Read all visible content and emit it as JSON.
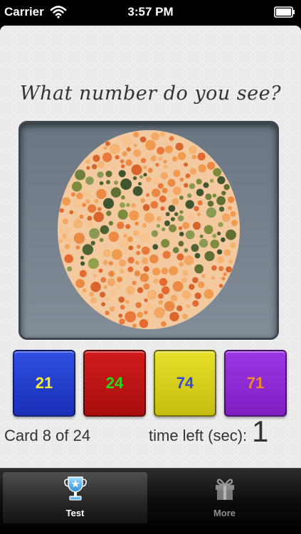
{
  "status_bar": {
    "carrier": "Carrier",
    "time": "3:57 PM",
    "wifi_icon": "wifi-icon",
    "battery_icon": "battery-icon"
  },
  "question": "What number do you see?",
  "plate": {
    "digits": "74",
    "icon": "ishihara-plate"
  },
  "answers": [
    {
      "label": "21",
      "bg": "#2438d8",
      "text_color": "#f2ee30"
    },
    {
      "label": "24",
      "bg": "#c01414",
      "text_color": "#27d81b"
    },
    {
      "label": "74",
      "bg": "#dcd41c",
      "text_color": "#3549cf"
    },
    {
      "label": "71",
      "bg": "#8d28d4",
      "text_color": "#f08a2a"
    }
  ],
  "card_count": "Card 8 of 24",
  "timer": {
    "label": "time left (sec):",
    "value": "1"
  },
  "tabs": [
    {
      "label": "Test",
      "icon": "trophy-icon",
      "selected": true
    },
    {
      "label": "More",
      "icon": "gift-icon",
      "selected": false
    }
  ]
}
